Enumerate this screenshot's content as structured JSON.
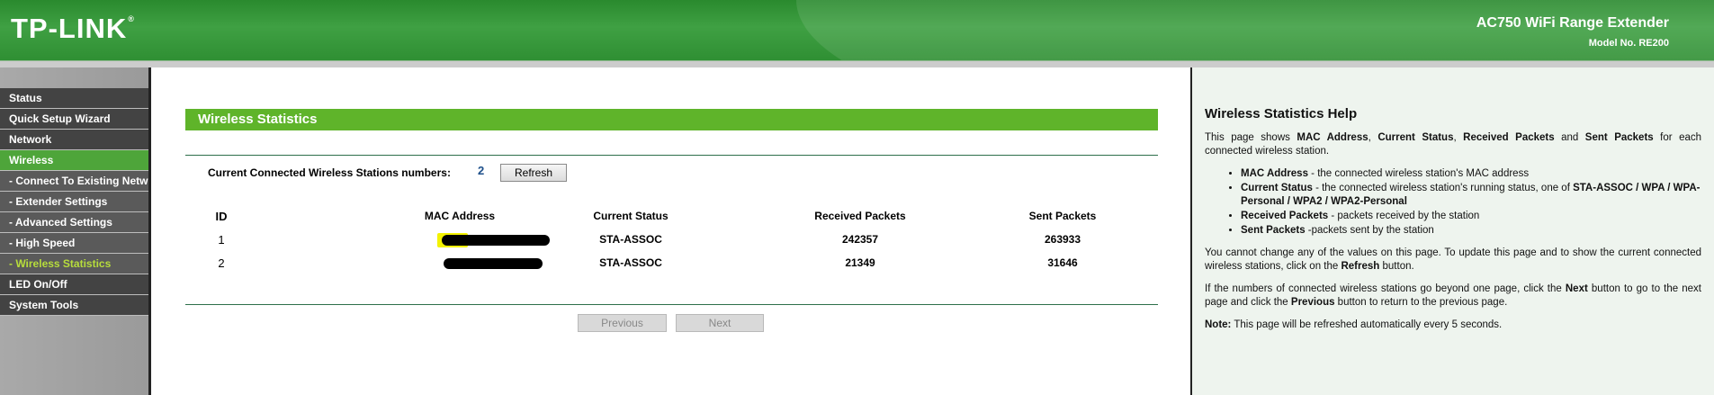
{
  "header": {
    "logo": "TP-LINK",
    "logo_mark": "®",
    "product": "AC750 WiFi Range Extender",
    "model": "Model No. RE200"
  },
  "sidebar": {
    "items": [
      {
        "label": "Status",
        "type": "main"
      },
      {
        "label": "Quick Setup Wizard",
        "type": "main"
      },
      {
        "label": "Network",
        "type": "main"
      },
      {
        "label": "Wireless",
        "type": "main",
        "active": true
      },
      {
        "label": "- Connect To Existing Network",
        "type": "sub"
      },
      {
        "label": "- Extender Settings",
        "type": "sub"
      },
      {
        "label": "- Advanced Settings",
        "type": "sub"
      },
      {
        "label": "- High Speed",
        "type": "sub"
      },
      {
        "label": "- Wireless Statistics",
        "type": "sub",
        "current": true
      },
      {
        "label": "LED On/Off",
        "type": "main"
      },
      {
        "label": "System Tools",
        "type": "main"
      }
    ]
  },
  "main": {
    "title": "Wireless Statistics",
    "stations_label": "Current Connected Wireless Stations numbers:",
    "stations_count": "2",
    "refresh_label": "Refresh",
    "table": {
      "headers": [
        "ID",
        "MAC Address",
        "Current Status",
        "Received Packets",
        "Sent Packets"
      ],
      "rows": [
        {
          "id": "1",
          "mac": "",
          "status": "STA-ASSOC",
          "received": "242357",
          "sent": "263933"
        },
        {
          "id": "2",
          "mac": "",
          "status": "STA-ASSOC",
          "received": "21349",
          "sent": "31646"
        }
      ]
    },
    "previous_label": "Previous",
    "next_label": "Next"
  },
  "help": {
    "title": "Wireless Statistics Help",
    "intro": {
      "t1": "This page shows ",
      "b1": "MAC Address",
      "t2": ", ",
      "b2": "Current Status",
      "t3": ", ",
      "b3": "Received Packets",
      "t4": " and ",
      "b4": "Sent Packets",
      "t5": " for each connected wireless station."
    },
    "bullets": [
      {
        "term": "MAC Address",
        "text": " - the connected wireless station's MAC address"
      },
      {
        "term": "Current Status",
        "text": " - the connected wireless station's running status, one of ",
        "extra": "STA-ASSOC / WPA / WPA-Personal / WPA2 / WPA2-Personal"
      },
      {
        "term": "Received Packets",
        "text": " - packets received by the station"
      },
      {
        "term": "Sent Packets",
        "text": " -packets sent by the station"
      }
    ],
    "para2": {
      "t1": "You cannot change any of the values on this page. To update this page and to show the current connected wireless stations, click on the ",
      "b1": "Refresh",
      "t2": " button."
    },
    "para3": {
      "t1": "If the numbers of connected wireless stations go beyond one page, click the ",
      "b1": "Next",
      "t2": " button to go to the next page and click the ",
      "b2": "Previous",
      "t3": " button to return to the previous page."
    },
    "note": {
      "b1": "Note:",
      "t1": " This page will be refreshed automatically every 5 seconds."
    }
  },
  "colors": {
    "header_green": "#3fa043",
    "accent_green": "#5fb42a",
    "sidebar_dark": "#434343",
    "current_sub": "#b7dd3c",
    "count_blue": "#1d4f8a"
  }
}
